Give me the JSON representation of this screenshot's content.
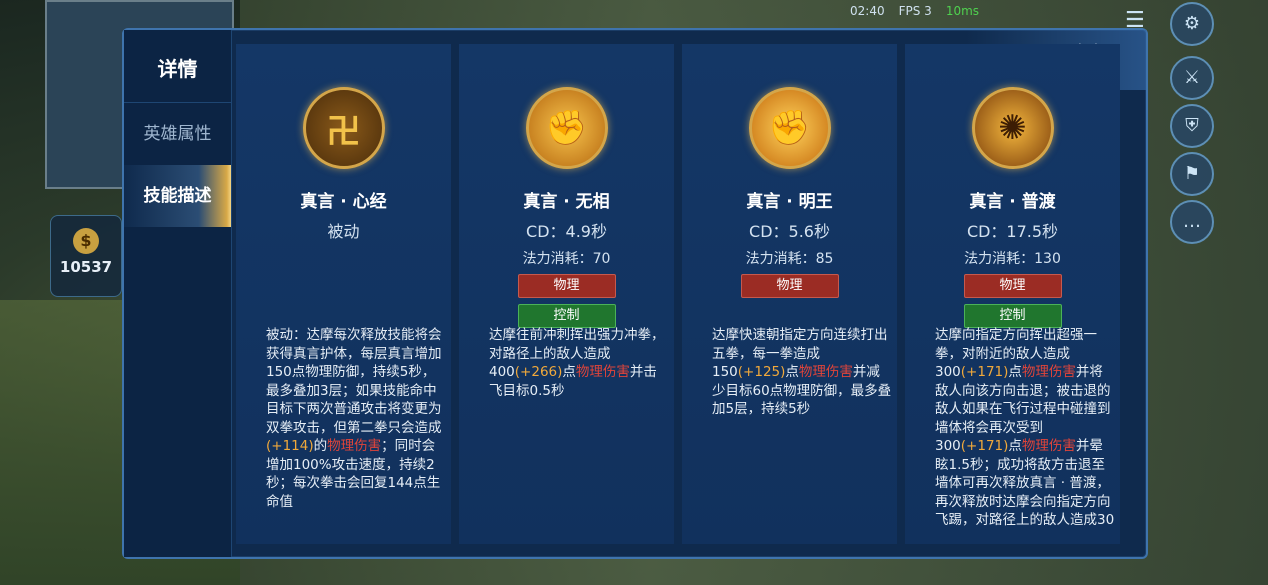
{
  "status": {
    "time": "02:40",
    "fps": "FPS 3",
    "ping": "10ms"
  },
  "hud": {
    "gold": "10537",
    "gold_icon": "coin-bag-icon"
  },
  "dialog": {
    "sidebar_title": "详情",
    "tabs": [
      {
        "label": "英雄属性"
      },
      {
        "label": "技能描述"
      }
    ],
    "active_tab": "技能描述",
    "close_label": "✕"
  },
  "skills": [
    {
      "name": "真言 · 心经",
      "sub": "被动",
      "icon": "wheel-emblem-icon",
      "desc": [
        {
          "t": "被动：达摩每次释放技能将会获得真言护体，每层真言增加150点物理防御，持续5秒，最多叠加3层；如果技能命中目标下两次普通攻击将变更为双拳攻击，但第二拳只会造成"
        },
        {
          "t": "(+114)",
          "c": "o"
        },
        {
          "t": "的"
        },
        {
          "t": "物理伤害",
          "c": "r"
        },
        {
          "t": "；同时会增加100%攻击速度，持续2秒；每次拳击会回复144点生命值"
        }
      ]
    },
    {
      "name": "真言 · 无相",
      "sub": "CD：4.9秒",
      "cost": "法力消耗：70",
      "tags": [
        "物理",
        "控制"
      ],
      "icon": "fist-icon",
      "desc": [
        {
          "t": "达摩往前冲刺挥出强力冲拳，对路径上的敌人造成400"
        },
        {
          "t": "(+266)",
          "c": "o"
        },
        {
          "t": "点"
        },
        {
          "t": "物理伤害",
          "c": "r"
        },
        {
          "t": "并击飞目标0.5秒"
        }
      ]
    },
    {
      "name": "真言 · 明王",
      "sub": "CD：5.6秒",
      "cost": "法力消耗：85",
      "tags": [
        "物理"
      ],
      "icon": "multi-fist-icon",
      "desc": [
        {
          "t": "达摩快速朝指定方向连续打出五拳，每一拳造成150"
        },
        {
          "t": "(+125)",
          "c": "o"
        },
        {
          "t": "点"
        },
        {
          "t": "物理伤害",
          "c": "r"
        },
        {
          "t": "并减少目标60点物理防御，最多叠加5层，持续5秒"
        }
      ]
    },
    {
      "name": "真言 · 普渡",
      "sub": "CD：17.5秒",
      "cost": "法力消耗：130",
      "tags": [
        "物理",
        "控制"
      ],
      "icon": "swirl-punch-icon",
      "desc": [
        {
          "t": "达摩向指定方向挥出超强一拳，对附近的敌人造成300"
        },
        {
          "t": "(+171)",
          "c": "o"
        },
        {
          "t": "点"
        },
        {
          "t": "物理伤害",
          "c": "r"
        },
        {
          "t": "并将敌人向该方向击退；被击退的敌人如果在飞行过程中碰撞到墙体将会再次受到300"
        },
        {
          "t": "(+171)",
          "c": "o"
        },
        {
          "t": "点"
        },
        {
          "t": "物理伤害",
          "c": "r"
        },
        {
          "t": "并晕眩1.5秒；成功将敌方击退至墙体可再次释放真言 · 普渡，再次释放时达摩会向指定方向飞踢，对路径上的敌人造成30"
        }
      ]
    }
  ]
}
